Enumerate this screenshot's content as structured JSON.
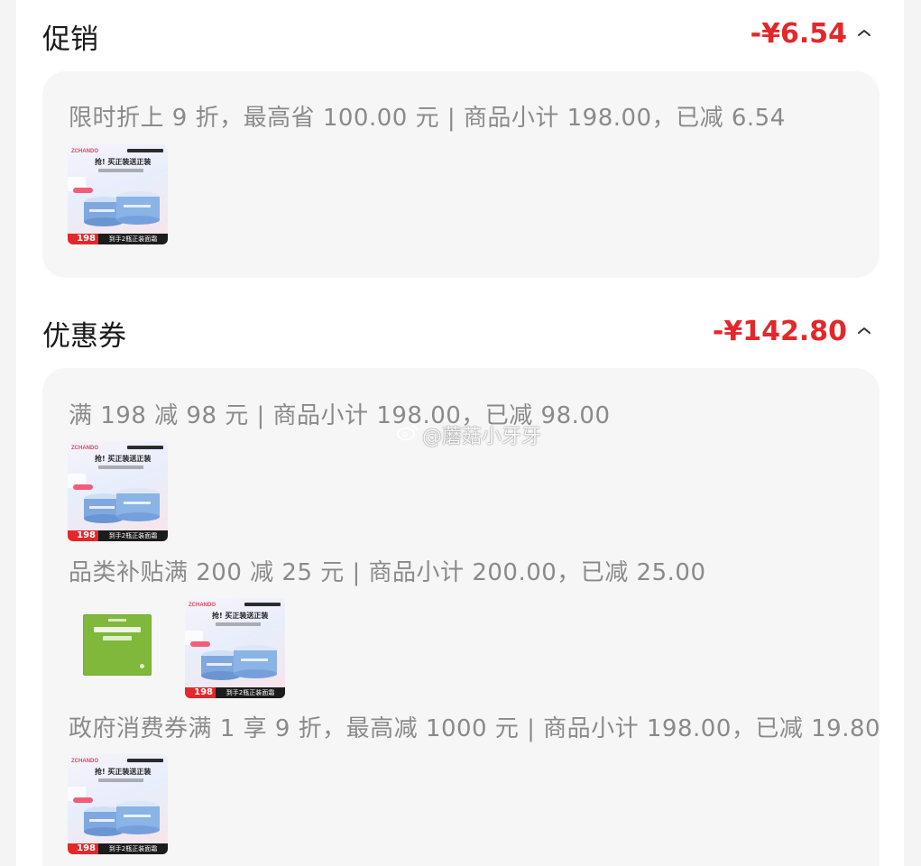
{
  "promotion": {
    "title": "促销",
    "amount": "-¥6.54",
    "rules": [
      {
        "text": "限时折上 9 折，最高省 100.00 元 | 商品小计 198.00，已减 6.54"
      }
    ]
  },
  "coupons": {
    "title": "优惠券",
    "amount": "-¥142.80",
    "rules": [
      {
        "text": "满 198 减 98 元 | 商品小计 198.00，已减 98.00"
      },
      {
        "text": "品类补贴满 200 减 25 元 | 商品小计 200.00，已减 25.00"
      },
      {
        "text": "政府消费券满 1 享 9 折，最高减 1000 元 | 商品小计 198.00，已减 19.80"
      }
    ]
  },
  "product": {
    "brand": "ZCHANDO",
    "headline": "抢! 买正装送正装",
    "price": "198",
    "promo_strip": "到手2瓶正装面霜"
  },
  "watermark": "@蘑菇小牙牙",
  "colors": {
    "accent_red": "#e4272a",
    "card_bg": "#f6f6f6",
    "rule_text": "#8a8a8a"
  },
  "icons": {
    "chevron": "chevron-up-icon",
    "watermark_logo": "weibo-icon"
  }
}
